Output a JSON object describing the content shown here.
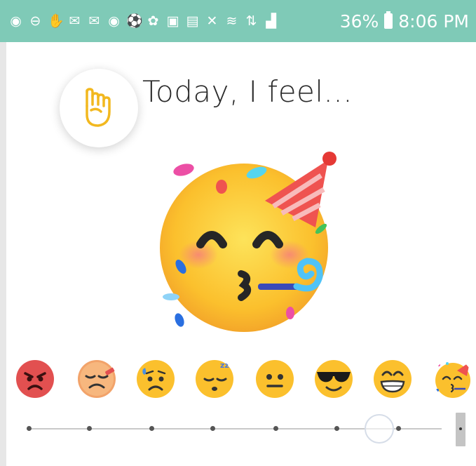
{
  "status_bar": {
    "icons": [
      "messenger-icon",
      "do-not-disturb-icon",
      "hand-icon",
      "gmail-icon",
      "gmail-icon",
      "messenger-icon",
      "soccer-icon",
      "app-icon",
      "battery-saver-icon",
      "cast-icon",
      "mute-icon",
      "wifi-icon",
      "data-icon",
      "signal-icon"
    ],
    "battery": "36%",
    "time": "8:06 PM"
  },
  "header": {
    "title": "Today, I feel..."
  },
  "selected_mood": {
    "icon": "partying-face-icon"
  },
  "mood_options": [
    "angry-face-icon",
    "tired-face-icon",
    "anxious-face-icon",
    "sleeping-face-icon",
    "neutral-face-icon",
    "sunglasses-face-icon",
    "grinning-face-icon",
    "partying-face-icon"
  ],
  "slider": {
    "stops": 8,
    "selected_index": 7
  },
  "colors": {
    "status_bar": "#7fcab7",
    "accent": "#f2b81f",
    "emoji_yellow": "#fbc02d"
  }
}
